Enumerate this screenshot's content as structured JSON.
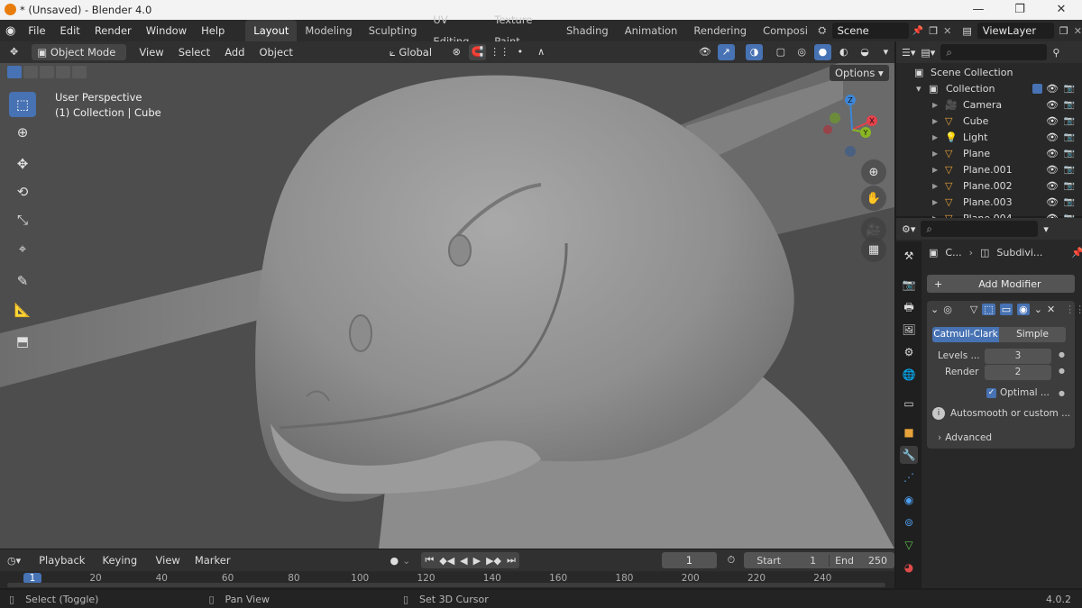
{
  "window": {
    "title": "* (Unsaved) - Blender 4.0",
    "controls": [
      "—",
      "❐",
      "✕"
    ]
  },
  "menu": [
    "File",
    "Edit",
    "Render",
    "Window",
    "Help"
  ],
  "workspaces": [
    "Layout",
    "Modeling",
    "Sculpting",
    "UV Editing",
    "Texture Paint",
    "Shading",
    "Animation",
    "Rendering",
    "Compositing"
  ],
  "scene_name": "Scene",
  "view_layer": "ViewLayer",
  "viewport_header": {
    "mode": "Object Mode",
    "menus": [
      "View",
      "Select",
      "Add",
      "Object"
    ],
    "orientation": "Global",
    "options": "Options"
  },
  "viewport": {
    "info_line1": "User Perspective",
    "info_line2": "(1) Collection | Cube",
    "gizmo": {
      "z": "Z",
      "x": "X",
      "y": "Y"
    },
    "colors": {
      "x": "#e5414b",
      "y": "#8ab623",
      "z": "#3d86d8",
      "active": "#4772b3"
    }
  },
  "outliner": {
    "search_placeholder": "",
    "scene_collection": "Scene Collection",
    "collection": "Collection",
    "items": [
      "Camera",
      "Cube",
      "Light",
      "Plane",
      "Plane.001",
      "Plane.002",
      "Plane.003",
      "Plane.004"
    ]
  },
  "properties": {
    "breadcrumb_object": "C...",
    "breadcrumb_modifier": "Subdivi...",
    "add_modifier": "Add Modifier",
    "mode_a": "Catmull-Clark",
    "mode_b": "Simple",
    "levels_label": "Levels ...",
    "levels_value": "3",
    "render_label": "Render",
    "render_value": "2",
    "optimal_label": "Optimal ...",
    "optimal_checked": true,
    "info_text": "Autosmooth or custom ...",
    "advanced": "Advanced"
  },
  "timeline": {
    "menus": [
      "Playback",
      "Keying",
      "View",
      "Marker"
    ],
    "current_frame": "1",
    "start_label": "Start",
    "start_value": "1",
    "end_label": "End",
    "end_value": "250",
    "ticks": [
      "1",
      "20",
      "40",
      "60",
      "80",
      "100",
      "120",
      "140",
      "160",
      "180",
      "200",
      "220",
      "240"
    ]
  },
  "status": {
    "select": "Select (Toggle)",
    "pan": "Pan View",
    "cursor": "Set 3D Cursor",
    "version": "4.0.2"
  }
}
